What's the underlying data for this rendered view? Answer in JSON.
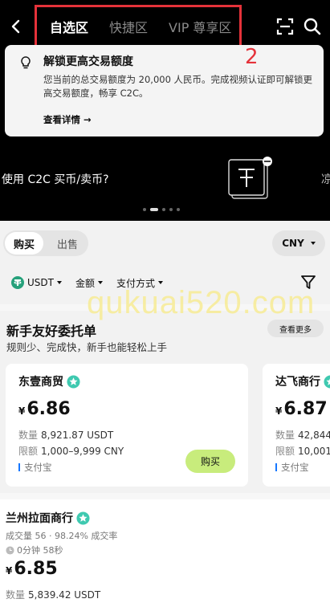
{
  "header": {
    "tabs": [
      {
        "label": "自选区",
        "active": true
      },
      {
        "label": "快捷区",
        "active": false
      },
      {
        "label": "VIP 尊享区",
        "active": false
      }
    ],
    "annotation_number": "2",
    "accent_color": "#e5323a"
  },
  "notice": {
    "title": "解锁更高交易额度",
    "body": "您当前的总交易额度为 20,000 人民币。完成视频认证即可解锁更高交易额度，畅享 C2C。",
    "link": "查看详情 →"
  },
  "banner": {
    "text": "使用 C2C 买币/卖币?",
    "next_peek": "凉",
    "dots": 5,
    "active_dot": 1
  },
  "trade": {
    "buy_label": "购买",
    "sell_label": "出售",
    "currency": "CNY"
  },
  "filters": {
    "coin": "USDT",
    "amount": "金额",
    "payment": "支付方式"
  },
  "watermark": "qukuai520.com",
  "newbie": {
    "title": "新手友好委托单",
    "subtitle": "规则少、完成快，新手也能轻松上手",
    "see_more": "查看更多",
    "cards": [
      {
        "merchant": "东壹商贸",
        "currency_symbol": "¥",
        "price": "6.86",
        "quantity_label": "数量",
        "quantity": "8,921.87 USDT",
        "limit_label": "限额",
        "limit": "1,000–9,999 CNY",
        "payment": "支付宝",
        "action": "购买"
      },
      {
        "merchant": "达飞商行",
        "currency_symbol": "¥",
        "price": "6.87",
        "quantity_label": "数量",
        "quantity": "42,844",
        "limit_label": "限额",
        "limit": "10,001",
        "payment": "支付宝"
      }
    ]
  },
  "listing": {
    "merchant": "兰州拉面商行",
    "stats": "成交量 56 · 98.24% 成交率",
    "time": "0分钟 58秒",
    "currency_symbol": "¥",
    "price": "6.85",
    "quantity_label": "数量",
    "quantity": "5,839.42 USDT"
  },
  "colors": {
    "buy_button": "#c8ec7c",
    "verified_badge": "#3fc9b0",
    "payment_marker": "#1677ff",
    "tether": "#26a17b"
  }
}
